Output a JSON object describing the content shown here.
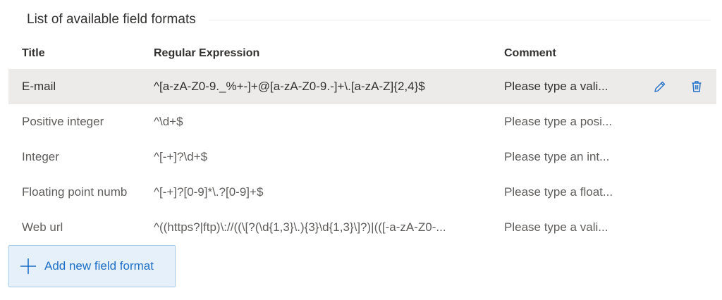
{
  "section": {
    "title": "List of available field formats"
  },
  "table": {
    "columns": [
      "Title",
      "Regular Expression",
      "Comment"
    ],
    "rows": [
      {
        "title": "E-mail",
        "regex": "^[a-zA-Z0-9._%+-]+@[a-zA-Z0-9.-]+\\.[a-zA-Z]{2,4}$",
        "comment": "Please type a vali..."
      },
      {
        "title": "Positive integer",
        "regex": "^\\d+$",
        "comment": "Please type a posi..."
      },
      {
        "title": "Integer",
        "regex": "^[-+]?\\d+$",
        "comment": "Please type an int..."
      },
      {
        "title": "Floating point numb",
        "regex": "^[-+]?[0-9]*\\.?[0-9]+$",
        "comment": "Please type a float..."
      },
      {
        "title": "Web url",
        "regex": "^((https?|ftp)\\://((\\[?(\\d{1,3}\\.){3}\\d{1,3}\\]?)|(([-a-zA-Z0-...",
        "comment": "Please type a vali..."
      }
    ],
    "selected_row_index": 0,
    "row_actions": {
      "edit_icon": "pencil-icon",
      "delete_icon": "trash-icon"
    }
  },
  "add_button": {
    "label": "Add new field format",
    "icon": "plus-icon"
  },
  "colors": {
    "accent": "#1e6fc7",
    "selected_row": "#edebe9",
    "add_button_bg": "#e6f0fa"
  }
}
